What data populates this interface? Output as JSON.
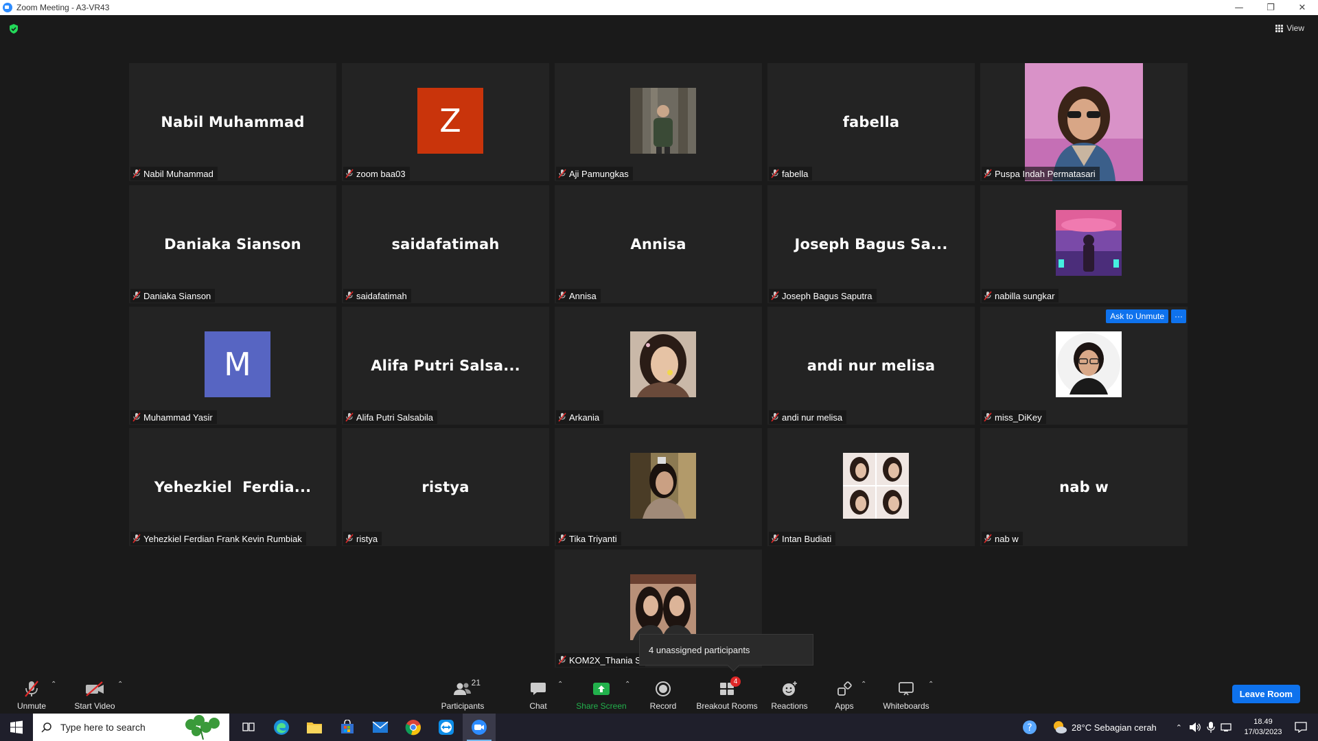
{
  "window": {
    "title": "Zoom Meeting - A3-VR43",
    "minimize": "—",
    "restore": "❐",
    "close": "✕"
  },
  "view_button": {
    "label": "View"
  },
  "tiles": [
    {
      "display": "Nabil Muhammad",
      "label": "Nabil Muhammad"
    },
    {
      "letter": "Z",
      "label": "zoom baa03"
    },
    {
      "photo": true,
      "label": "Aji Pamungkas"
    },
    {
      "display": "fabella",
      "label": "fabella"
    },
    {
      "photo": true,
      "label": "Puspa Indah Permatasari"
    },
    {
      "display": "Daniaka Sianson",
      "label": "Daniaka Sianson"
    },
    {
      "display": "saidafatimah",
      "label": "saidafatimah"
    },
    {
      "display": "Annisa",
      "label": "Annisa"
    },
    {
      "display": "Joseph Bagus Sa...",
      "label": "Joseph Bagus Saputra"
    },
    {
      "photo": true,
      "label": "nabilla sungkar"
    },
    {
      "letter": "M",
      "label": "Muhammad Yasir"
    },
    {
      "display": "Alifa Putri Salsa...",
      "label": "Alifa Putri Salsabila"
    },
    {
      "photo": true,
      "label": "Arkania"
    },
    {
      "display": "andi nur melisa",
      "label": "andi nur melisa"
    },
    {
      "photo": true,
      "label": "miss_DiKey"
    },
    {
      "display": "Yehezkiel  Ferdia...",
      "label": "Yehezkiel Ferdian Frank Kevin Rumbiak"
    },
    {
      "display": "ristya",
      "label": "ristya"
    },
    {
      "photo": true,
      "label": "Tika Triyanti"
    },
    {
      "photo": true,
      "label": "Intan Budiati"
    },
    {
      "display": "nab w",
      "label": "nab w"
    },
    {
      "photo": true,
      "label": "KOM2X_Thania S"
    }
  ],
  "hover_controls": {
    "ask_to_unmute": "Ask to Unmute",
    "more": "···"
  },
  "tooltip": "4 unassigned participants",
  "toolbar": {
    "unmute": "Unmute",
    "start_video": "Start Video",
    "participants": "Participants",
    "participants_count": "21",
    "chat": "Chat",
    "share_screen": "Share Screen",
    "record": "Record",
    "breakout_rooms": "Breakout Rooms",
    "breakout_badge": "4",
    "reactions": "Reactions",
    "apps": "Apps",
    "whiteboards": "Whiteboards",
    "leave": "Leave Room"
  },
  "taskbar": {
    "search_placeholder": "Type here to search",
    "weather": "28°C  Sebagian cerah",
    "time": "18.49",
    "date": "17/03/2023"
  },
  "colors": {
    "accent": "#0e72ed",
    "share_green": "#22b14c",
    "z_avatar": "#c9340b",
    "m_avatar": "#5765c2"
  }
}
